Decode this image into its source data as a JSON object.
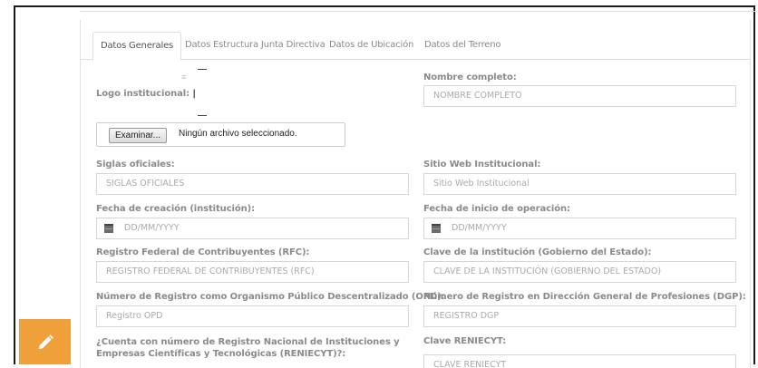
{
  "tabs": [
    {
      "label": "Datos Generales",
      "active": true
    },
    {
      "label": "Datos Estructura Junta Directiva",
      "active": false
    },
    {
      "label": "Datos de Ubicación",
      "active": false
    },
    {
      "label": "Datos del Terreno",
      "active": false
    }
  ],
  "logo": {
    "label": "Logo institucional:",
    "cursor_char": "|"
  },
  "file_input": {
    "button_label": "Examinar...",
    "status_text": "Ningún archivo seleccionado."
  },
  "fields": {
    "nombre_completo": {
      "label": "Nombre completo:",
      "placeholder": "NOMBRE COMPLETO"
    },
    "siglas": {
      "label": "Siglas oficiales:",
      "placeholder": "SIGLAS OFICIALES"
    },
    "sitio_web": {
      "label": "Sitio Web Institucional:",
      "placeholder": "Sitio Web Institucional"
    },
    "fecha_creacion": {
      "label": "Fecha de creación (institución):",
      "placeholder": "DD/MM/YYYY"
    },
    "fecha_inicio": {
      "label": "Fecha de inicio de operación:",
      "placeholder": "DD/MM/YYYY"
    },
    "rfc": {
      "label": "Registro Federal de Contribuyentes (RFC):",
      "placeholder": "REGISTRO FEDERAL DE CONTRIBUYENTES (RFC)"
    },
    "clave_institucion": {
      "label": "Clave de la institución (Gobierno del Estado):",
      "placeholder": "CLAVE DE LA INSTITUCIÓN (GOBIERNO DEL ESTADO)"
    },
    "registro_opd": {
      "label": "Número de Registro como Organismo Público Descentralizado (OPD):",
      "placeholder": "Registro OPD"
    },
    "registro_dgp": {
      "label": "Número de Registro en Dirección General de Profesiones (DGP):",
      "placeholder": "REGISTRO DGP"
    },
    "reniecyt_pregunta": {
      "label": "¿Cuenta con número de Registro Nacional de Instituciones y Empresas Científicas y Tecnológicas (RENIECYT)?:"
    },
    "clave_reniecyt": {
      "label": "Clave RENIECYT:",
      "placeholder": "CLAVE RENIECYT"
    }
  },
  "fab": {
    "icon": "pencil-icon",
    "color": "#f0a03b"
  }
}
